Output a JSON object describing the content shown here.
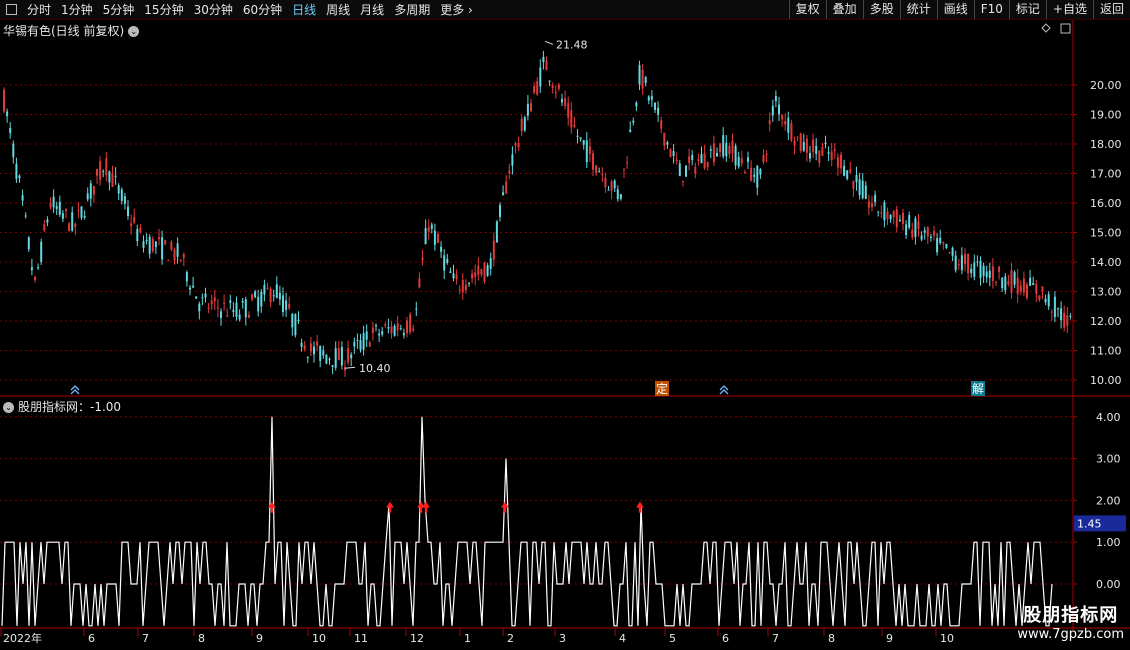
{
  "toolbar": {
    "periods": [
      "分时",
      "1分钟",
      "5分钟",
      "15分钟",
      "30分钟",
      "60分钟",
      "日线",
      "周线",
      "月线",
      "多周期",
      "更多"
    ],
    "active_period": "日线",
    "more_arrow": "›",
    "right_items": [
      "复权",
      "叠加",
      "多股",
      "统计",
      "画线",
      "F10",
      "标记",
      "+自选",
      "返回"
    ]
  },
  "price_panel": {
    "title": "华锡有色(日线 前复权)",
    "y_ticks": [
      "20.00",
      "19.00",
      "18.00",
      "17.00",
      "16.00",
      "15.00",
      "14.00",
      "13.00",
      "12.00",
      "11.00",
      "10.00"
    ],
    "y_values": [
      20,
      19,
      18,
      17,
      16,
      15,
      14,
      13,
      12,
      11,
      10
    ],
    "high_label": "21.48",
    "low_label": "10.40",
    "markers": [
      {
        "text": "定",
        "bg": "#c05000"
      },
      {
        "text": "解",
        "bg": "#0a7a90"
      }
    ],
    "up_color": "#e2393b",
    "down_color": "#62d9e0"
  },
  "indicator_panel": {
    "title": "股朋指标网：-1.00",
    "y_ticks": [
      "4.00",
      "3.00",
      "2.00",
      "1.00",
      "0.00"
    ],
    "y_values": [
      4,
      3,
      2,
      1,
      0
    ],
    "current_value": "1.45",
    "current_value_bg": "#1a2a9a"
  },
  "x_axis": {
    "labels": [
      "2022年",
      "6",
      "7",
      "8",
      "9",
      "10",
      "11",
      "12",
      "1",
      "2",
      "3",
      "4",
      "5",
      "6",
      "7",
      "8",
      "9",
      "10"
    ]
  },
  "watermark": {
    "line1": "股朋指标网",
    "line2": "www.7gpzb.com"
  },
  "colors": {
    "grid": "#7a0000",
    "axis": "#b00000",
    "text": "#e6e6e6",
    "accent": "#6fd0ff"
  }
}
